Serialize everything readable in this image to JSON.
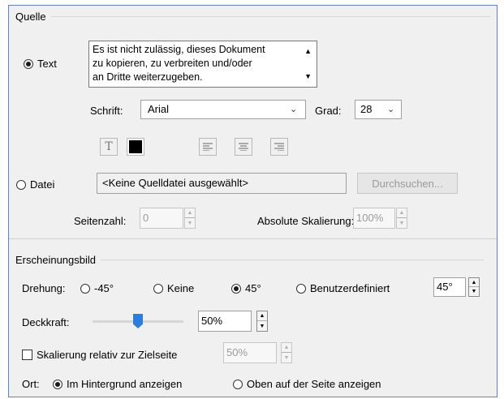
{
  "quelle": {
    "title": "Quelle",
    "text_option": "Text",
    "text_content": [
      "Es ist nicht zulässig, dieses Dokument",
      "zu kopieren, zu verbreiten und/oder",
      "an Dritte weiterzugeben."
    ],
    "font_label": "Schrift:",
    "font_value": "Arial",
    "size_label": "Grad:",
    "size_value": "28",
    "file_option": "Datei",
    "file_value": "<Keine Quelldatei ausgewählt>",
    "browse_label": "Durchsuchen...",
    "page_label": "Seitenzahl:",
    "page_value": "0",
    "scale_label": "Absolute Skalierung:",
    "scale_value": "100%",
    "text_color": "#000000"
  },
  "appearance": {
    "title": "Erscheinungsbild",
    "rotation_label": "Drehung:",
    "rotation_options": [
      "-45°",
      "Keine",
      "45°",
      "Benutzerdefiniert"
    ],
    "rotation_selected": "45°",
    "rotation_custom_value": "45°",
    "opacity_label": "Deckkraft:",
    "opacity_value": "50%",
    "opacity_fraction": 0.5,
    "relative_scale_label": "Skalierung relativ zur Zielseite",
    "relative_scale_value": "50%",
    "position_label": "Ort:",
    "position_options": [
      "Im Hintergrund anzeigen",
      "Oben auf der Seite anzeigen"
    ],
    "position_selected": "Im Hintergrund anzeigen",
    "slider_color": "#2b7de0"
  }
}
